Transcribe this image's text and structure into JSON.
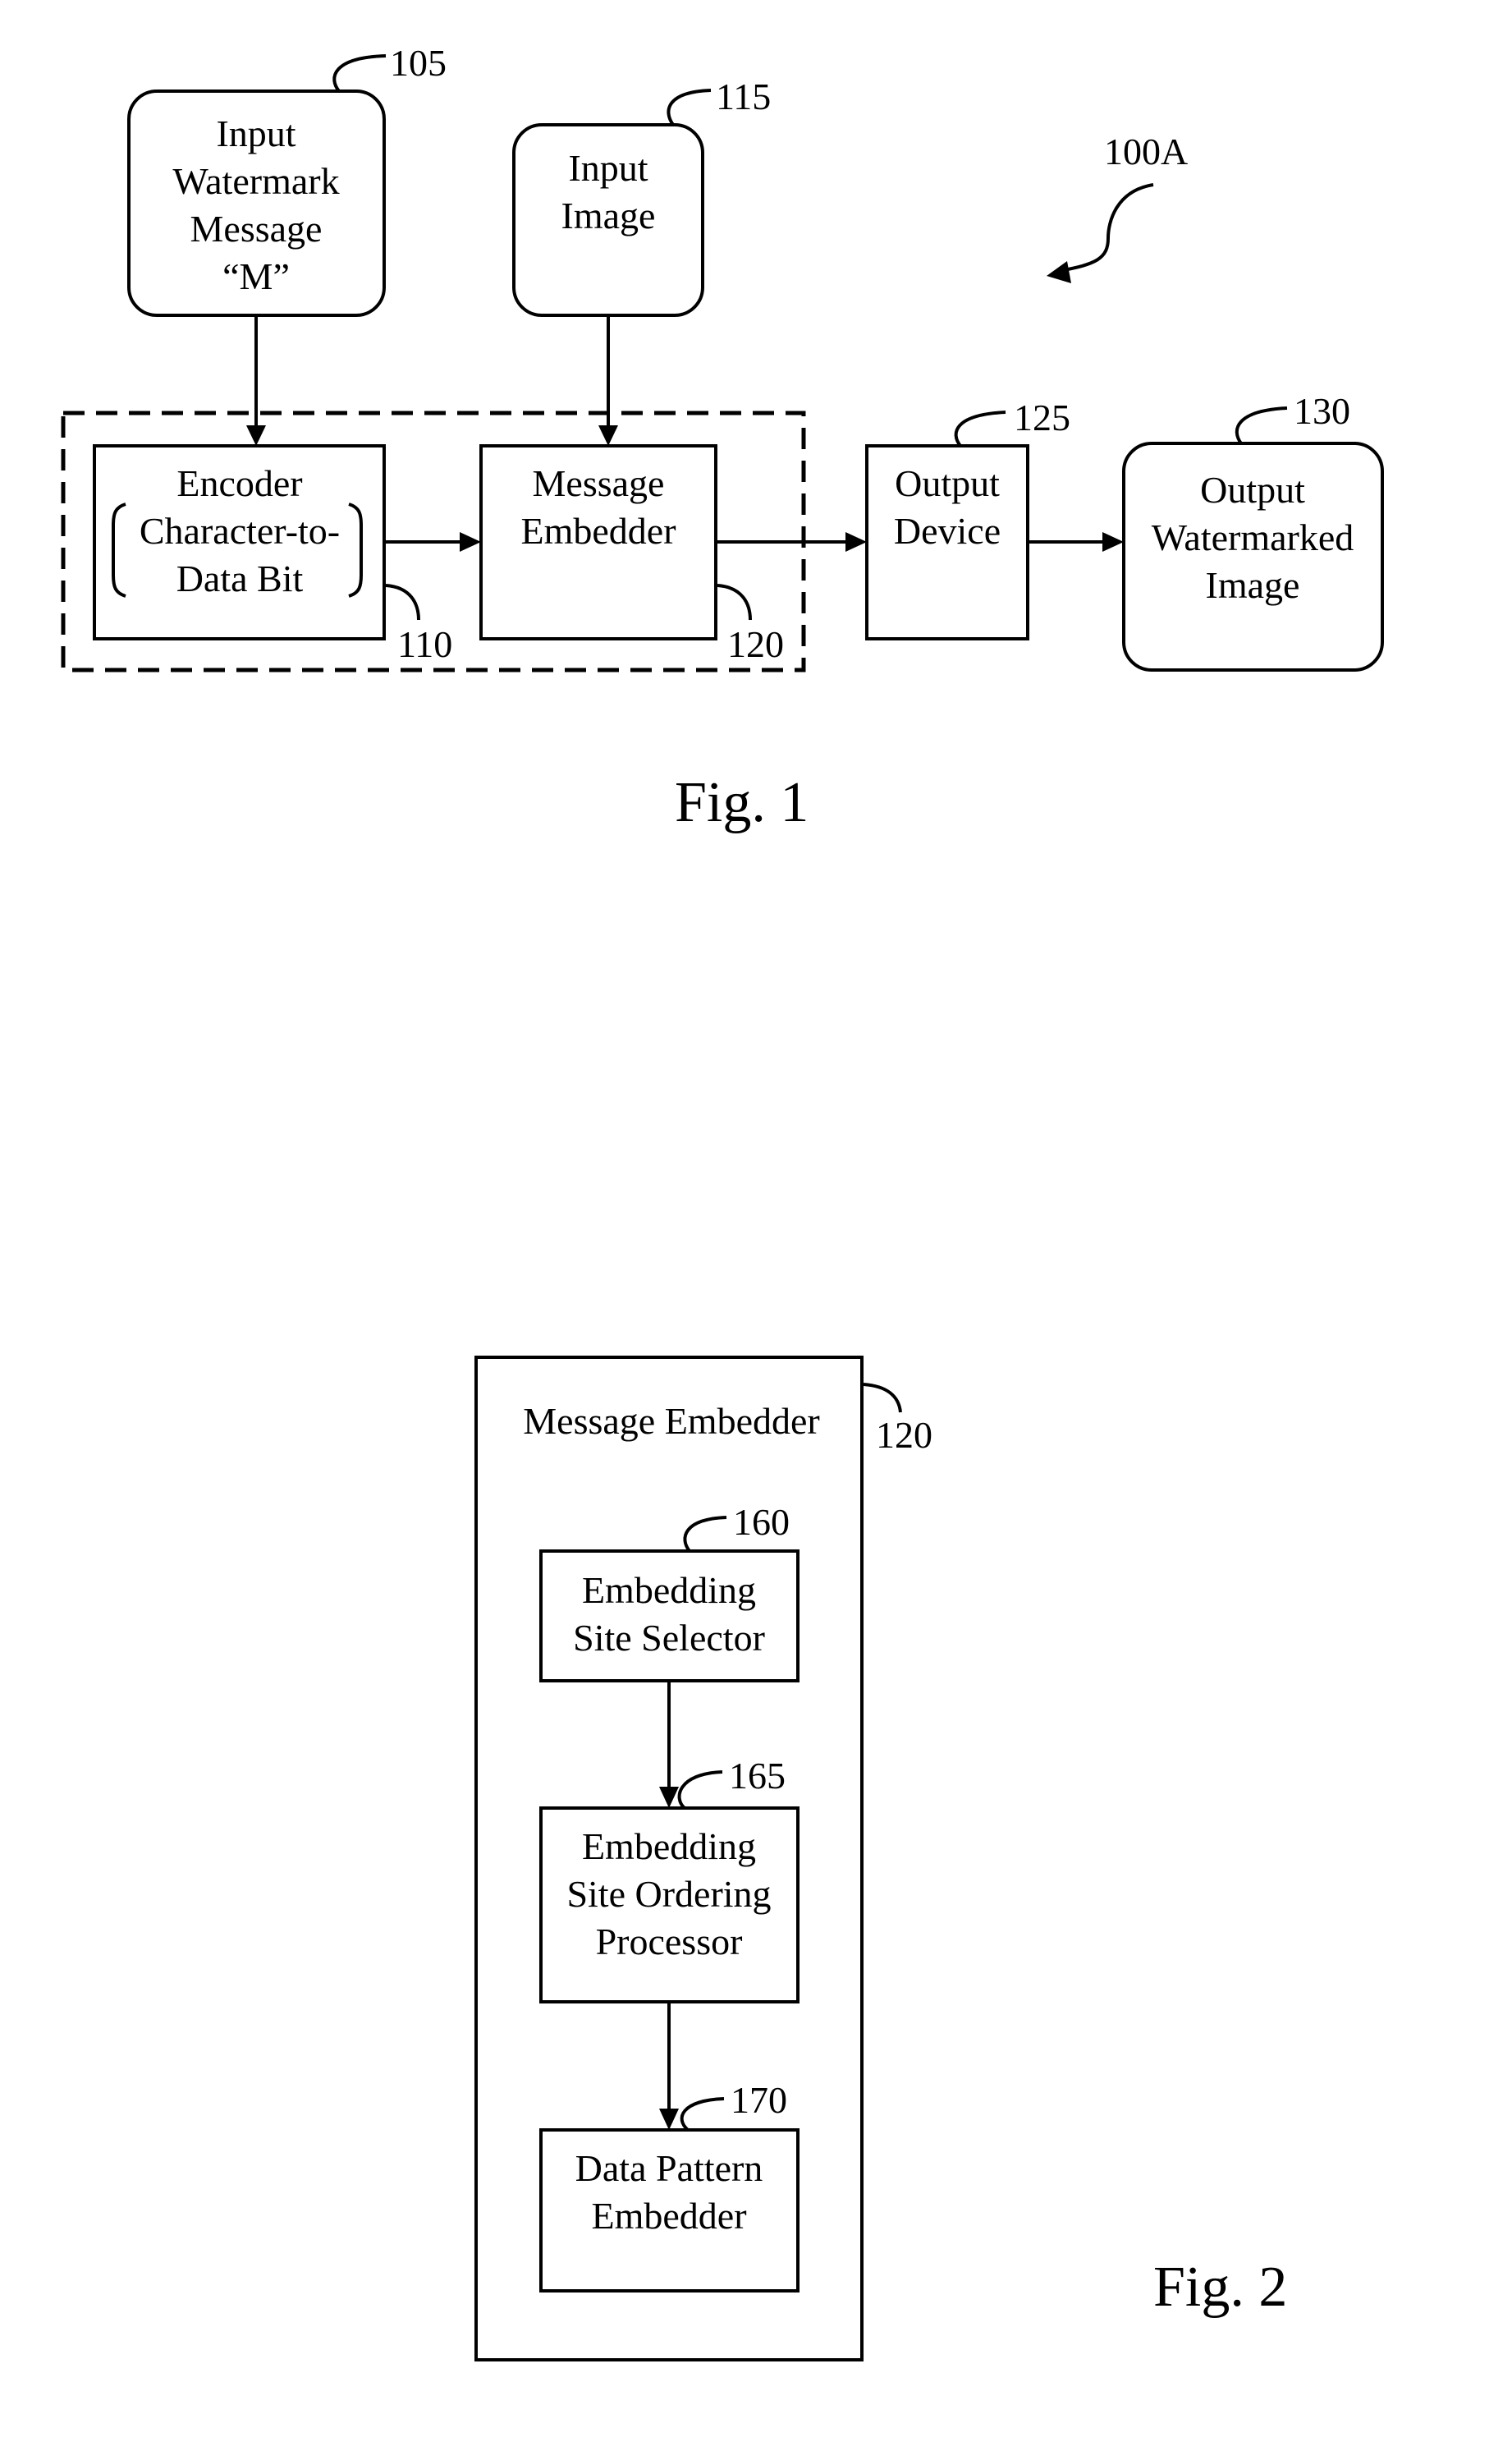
{
  "figure1": {
    "caption": "Fig. 1",
    "system_ref": "100A",
    "blocks": {
      "input_watermark": {
        "ref": "105",
        "lines": [
          "Input",
          "Watermark",
          "Message",
          "“M”"
        ]
      },
      "input_image": {
        "ref": "115",
        "lines": [
          "Input",
          "Image"
        ]
      },
      "encoder": {
        "ref": "110",
        "lines": [
          "Encoder",
          "Character-to-",
          "Data Bit"
        ]
      },
      "message_embedder": {
        "ref": "120",
        "lines": [
          "Message",
          "Embedder"
        ]
      },
      "output_device": {
        "ref": "125",
        "lines": [
          "Output",
          "Device"
        ]
      },
      "output_image": {
        "ref": "130",
        "lines": [
          "Output",
          "Watermarked",
          "Image"
        ]
      }
    }
  },
  "figure2": {
    "caption": "Fig. 2",
    "container": {
      "ref": "120",
      "title": "Message Embedder"
    },
    "blocks": {
      "site_selector": {
        "ref": "160",
        "lines": [
          "Embedding",
          "Site Selector"
        ]
      },
      "ordering_processor": {
        "ref": "165",
        "lines": [
          "Embedding",
          "Site Ordering",
          "Processor"
        ]
      },
      "pattern_embedder": {
        "ref": "170",
        "lines": [
          "Data Pattern",
          "Embedder"
        ]
      }
    }
  }
}
